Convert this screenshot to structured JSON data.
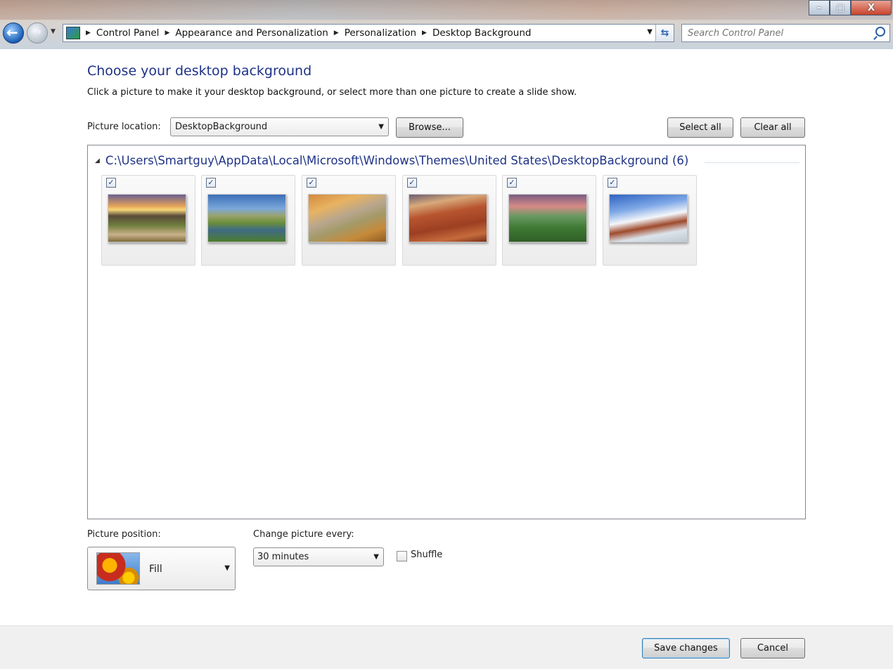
{
  "window": {
    "minimize_label": "–",
    "maximize_label": "▢",
    "close_label": "X"
  },
  "address_bar": {
    "breadcrumbs": [
      "Control Panel",
      "Appearance and Personalization",
      "Personalization",
      "Desktop Background"
    ]
  },
  "search": {
    "placeholder": "Search Control Panel"
  },
  "page": {
    "title": "Choose your desktop background",
    "description": "Click a picture to make it your desktop background, or select more than one picture to create a slide show."
  },
  "location": {
    "label": "Picture location:",
    "value": "DesktopBackground",
    "browse_label": "Browse...",
    "select_all_label": "Select all",
    "clear_all_label": "Clear all"
  },
  "gallery": {
    "group_title": "C:\\Users\\Smartguy\\AppData\\Local\\Microsoft\\Windows\\Themes\\United States\\DesktopBackground (6)",
    "items": [
      {
        "checked": true,
        "scene": "desert sunset with cacti"
      },
      {
        "checked": true,
        "scene": "barn by a stream"
      },
      {
        "checked": true,
        "scene": "autumn lake"
      },
      {
        "checked": true,
        "scene": "red rock canyon"
      },
      {
        "checked": true,
        "scene": "green misty valley"
      },
      {
        "checked": true,
        "scene": "snowy mountains blue sky"
      }
    ],
    "check_mark": "✓"
  },
  "picture_position": {
    "label": "Picture position:",
    "value": "Fill"
  },
  "interval": {
    "label": "Change picture every:",
    "value": "30 minutes"
  },
  "shuffle": {
    "label": "Shuffle",
    "checked": false
  },
  "footer": {
    "save_label": "Save changes",
    "cancel_label": "Cancel"
  }
}
